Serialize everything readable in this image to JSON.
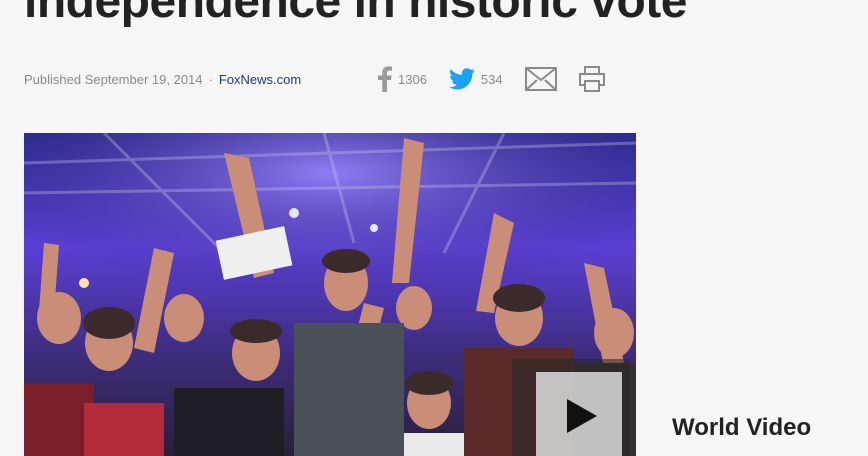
{
  "article": {
    "headline": "independence in historic vote",
    "published": "Published September 19, 2014",
    "separator": "·",
    "source": "FoxNews.com"
  },
  "share": {
    "facebook_count": "1306",
    "twitter_count": "534",
    "icons": [
      "facebook-icon",
      "twitter-icon",
      "mail-icon",
      "print-icon"
    ],
    "colors": {
      "facebook": "#9a9a9a",
      "twitter": "#1da1f2",
      "gray_icon": "#8a8a8a"
    }
  },
  "media": {
    "play_button": "play-icon"
  },
  "sidebar": {
    "title": "World Video"
  },
  "colors": {
    "page_bg": "#f6f6f6",
    "headline": "#222222",
    "meta": "#8a8a8a",
    "link": "#1d3c6e"
  }
}
